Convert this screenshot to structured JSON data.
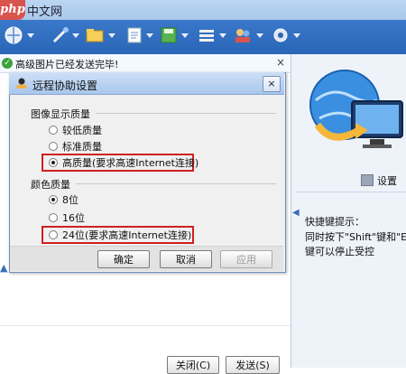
{
  "window": {
    "logo_text": "php",
    "title": "中文网"
  },
  "toolbar": {
    "icons": [
      "globe-icon",
      "tools-icon",
      "folder-icon",
      "document-icon",
      "save-icon",
      "list-icon",
      "people-icon",
      "settings-icon"
    ]
  },
  "notice": {
    "text": "高级图片已经发送完毕!",
    "close": "×"
  },
  "dialog": {
    "title": "远程协助设置",
    "close": "×",
    "image_quality": {
      "label": "图像显示质量",
      "options": [
        "较低质量",
        "标准质量",
        "高质量(要求高速Internet连接)"
      ],
      "selected": 2
    },
    "color_quality": {
      "label": "颜色质量",
      "options": [
        "8位",
        "16位",
        "24位(要求高速Internet连接)"
      ],
      "selected": 0
    },
    "buttons": {
      "ok": "确定",
      "cancel": "取消",
      "apply": "应用"
    }
  },
  "right": {
    "settings_label": "设置",
    "hotkey_title": "快捷键提示：",
    "hotkey_line1": "同时按下\"Shift\"键和\"ESC\"",
    "hotkey_line2": "键可以停止受控"
  },
  "bottom": {
    "close_label": "关闭(C)",
    "send_label": "发送(S)"
  },
  "colors": {
    "toolbar": "#2a66b8",
    "highlight": "#d02020",
    "dialog_bg": "#f0f0f0"
  }
}
